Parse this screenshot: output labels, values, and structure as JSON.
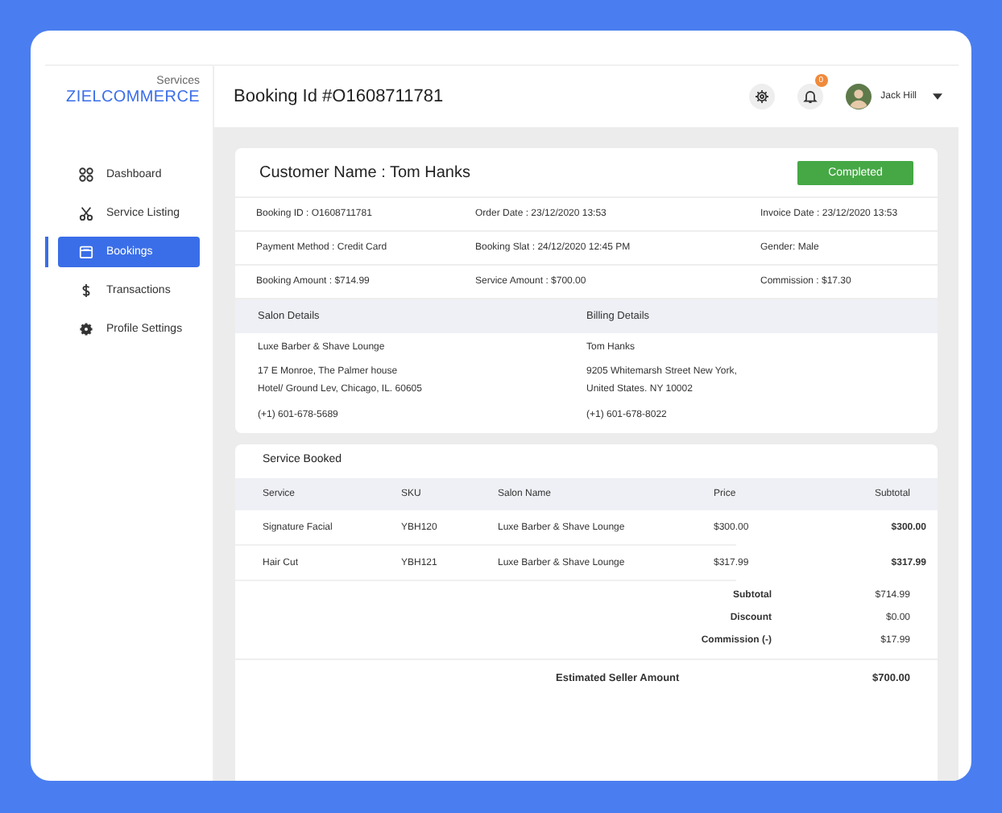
{
  "brand": {
    "subtitle": "Services",
    "name": "ZIELCOMMERCE"
  },
  "sidebar": {
    "items": [
      {
        "label": "Dashboard",
        "kind": "grid",
        "selected": false
      },
      {
        "label": "Service Listing",
        "kind": "scissors",
        "selected": false
      },
      {
        "label": "Bookings",
        "kind": "calendar",
        "selected": true
      },
      {
        "label": "Transactions",
        "kind": "dollar",
        "selected": false
      },
      {
        "label": "Profile Settings",
        "kind": "gear",
        "selected": false
      }
    ]
  },
  "header": {
    "title": "Booking Id #O1608711781",
    "notification_count": "0",
    "user": "Jack Hill"
  },
  "booking": {
    "customer": "Customer Name : Tom Hanks",
    "status": "Completed",
    "info_rows": [
      [
        "Booking ID : O1608711781",
        "Order Date : 23/12/2020 13:53",
        "Invoice Date : 23/12/2020 13:53"
      ],
      [
        "Payment Method : Credit Card",
        "Booking Slat : 24/12/2020 12:45 PM",
        "Gender: Male"
      ],
      [
        "Booking Amount : $714.99",
        "Service Amount : $700.00",
        "Commission : $17.30"
      ]
    ],
    "details": [
      {
        "heading": "Salon Details",
        "name": "Luxe Barber & Shave Lounge",
        "address": [
          "17 E Monroe, The Palmer house",
          "Hotel/ Ground Lev, Chicago, IL. 60605"
        ],
        "phone": "(+1) 601-678-5689"
      },
      {
        "heading": "Billing Details",
        "name": "Tom Hanks",
        "address": [
          "9205 Whitemarsh Street New York,",
          "United States. NY 10002"
        ],
        "phone": "(+1) 601-678-8022"
      }
    ]
  },
  "services": {
    "title": "Service Booked",
    "columns": [
      "Service",
      "SKU",
      "Salon  Name",
      "Price",
      "Subtotal"
    ],
    "rows": [
      [
        "Signature Facial",
        "YBH120",
        "Luxe Barber & Shave Lounge",
        "$300.00",
        "$300.00"
      ],
      [
        "Hair Cut",
        "YBH121",
        "Luxe Barber & Shave Lounge",
        "$317.99",
        "$317.99"
      ]
    ],
    "totals": [
      {
        "label": "Subtotal",
        "value": "$714.99"
      },
      {
        "label": "Discount",
        "value": "$0.00"
      },
      {
        "label": "Commission (-)",
        "value": "$17.99"
      }
    ],
    "estimated": {
      "label": "Estimated Seller Amount",
      "value": "$700.00"
    }
  }
}
